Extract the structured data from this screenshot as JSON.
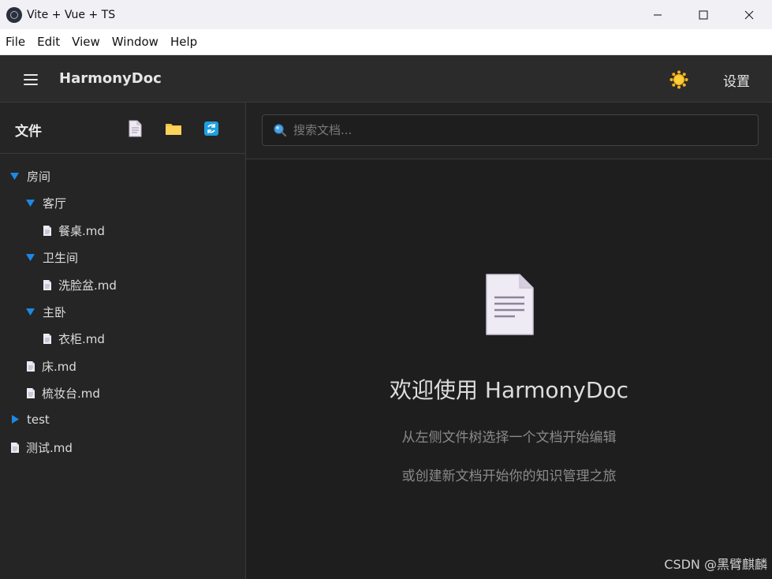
{
  "window": {
    "title": "Vite + Vue + TS"
  },
  "menu": [
    "File",
    "Edit",
    "View",
    "Window",
    "Help"
  ],
  "header": {
    "app_name": "HarmonyDoc",
    "settings_label": "设置"
  },
  "sidebar": {
    "title": "文件",
    "tree": [
      {
        "type": "folder",
        "expanded": true,
        "label": "房间",
        "depth": 0
      },
      {
        "type": "folder",
        "expanded": true,
        "label": "客厅",
        "depth": 1
      },
      {
        "type": "file",
        "label": "餐桌.md",
        "depth": 2
      },
      {
        "type": "folder",
        "expanded": true,
        "label": "卫生间",
        "depth": 1
      },
      {
        "type": "file",
        "label": "洗脸盆.md",
        "depth": 2
      },
      {
        "type": "folder",
        "expanded": true,
        "label": "主卧",
        "depth": 1
      },
      {
        "type": "file",
        "label": "衣柜.md",
        "depth": 2
      },
      {
        "type": "file",
        "label": "床.md",
        "depth": 1
      },
      {
        "type": "file",
        "label": "梳妆台.md",
        "depth": 1
      },
      {
        "type": "folder",
        "expanded": false,
        "label": "test",
        "depth": 0
      },
      {
        "type": "file",
        "label": "测试.md",
        "depth": 0
      }
    ]
  },
  "search": {
    "placeholder": "搜索文档...",
    "value": ""
  },
  "welcome": {
    "title": "欢迎使用 HarmonyDoc",
    "line1": "从左侧文件树选择一个文档开始编辑",
    "line2": "或创建新文档开始你的知识管理之旅"
  },
  "watermark": "CSDN @黑臂麒麟",
  "colors": {
    "accent": "#1e88e5",
    "folder": "#f5c242",
    "sun": "#f6b21a"
  }
}
